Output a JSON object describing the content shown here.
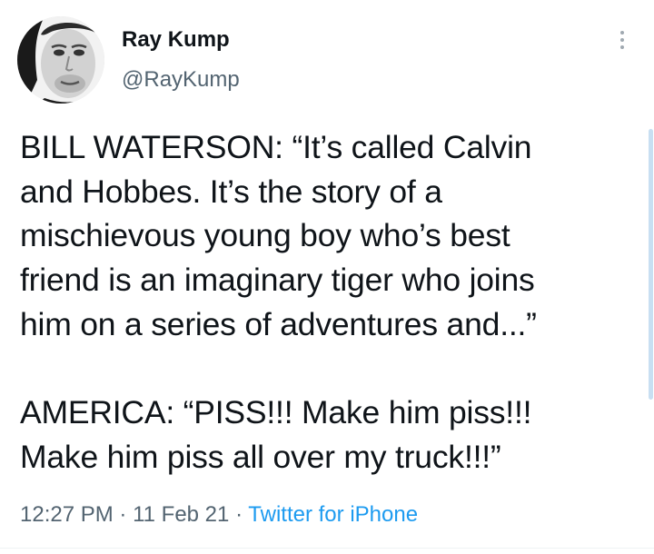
{
  "author": {
    "display_name": "Ray Kump",
    "handle": "@RayKump"
  },
  "tweet": {
    "lines": [
      "BILL WATERSON: “It’s called Calvin",
      "and Hobbes. It’s the story of a",
      "mischievous young boy who’s best",
      "friend is an imaginary tiger who joins",
      "him on a series of adventures and...”",
      "",
      "AMERICA: “PISS!!! Make him piss!!!",
      "Make him piss all over my truck!!!”"
    ]
  },
  "meta": {
    "time": "12:27 PM",
    "separator": "·",
    "date": "11 Feb 21",
    "source": "Twitter for iPhone"
  },
  "icons": {
    "more": "more-vertical-icon"
  },
  "colors": {
    "text": "#0f1419",
    "secondary": "#536471",
    "link": "#1d9bf0"
  }
}
